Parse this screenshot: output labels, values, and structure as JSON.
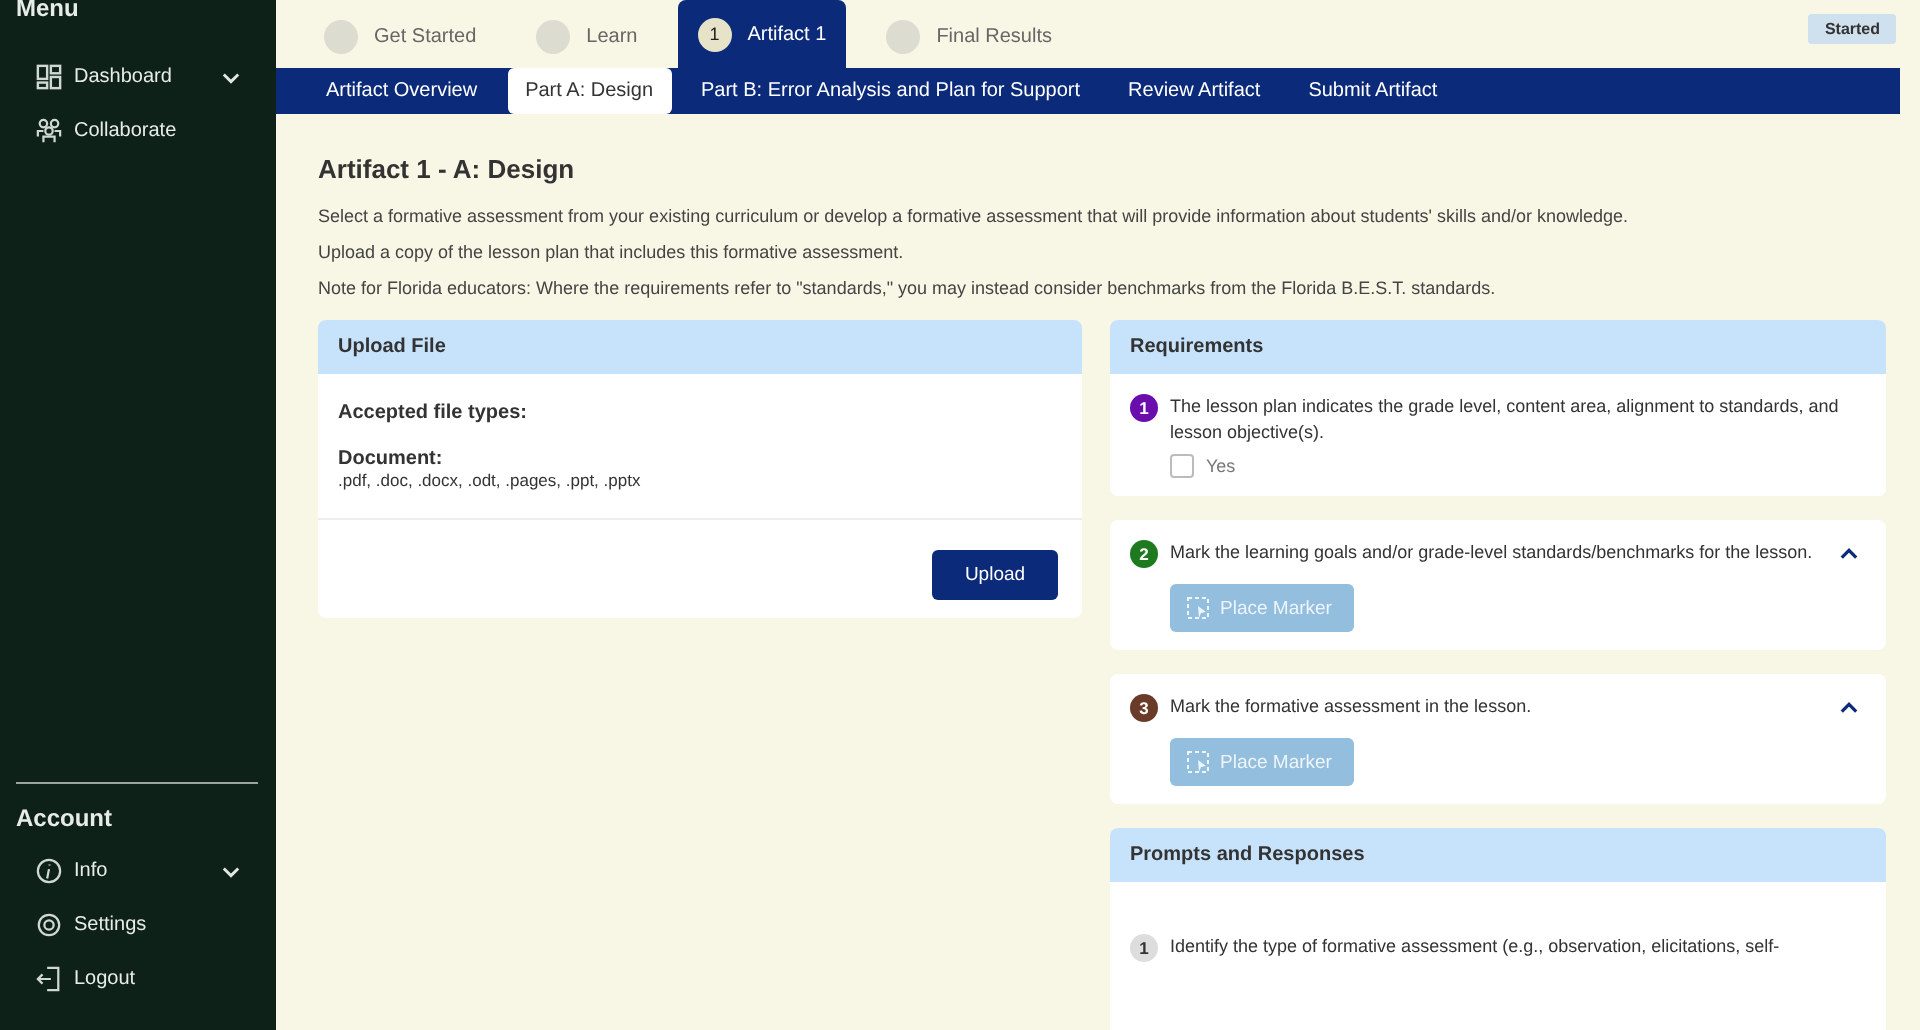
{
  "sidebar": {
    "menu_title": "Menu",
    "menu_items": [
      {
        "label": "Dashboard",
        "kind": "dashboard",
        "expandable": true
      },
      {
        "label": "Collaborate",
        "kind": "people",
        "expandable": false
      }
    ],
    "account_title": "Account",
    "account_items": [
      {
        "label": "Info",
        "kind": "info",
        "expandable": true
      },
      {
        "label": "Settings",
        "kind": "gear",
        "expandable": false
      },
      {
        "label": "Logout",
        "kind": "logout",
        "expandable": false
      }
    ]
  },
  "steps": [
    {
      "label": "Get Started",
      "selected": false
    },
    {
      "label": "Learn",
      "selected": false
    },
    {
      "label": "Artifact 1",
      "number": "1",
      "selected": true
    },
    {
      "label": "Final Results",
      "selected": false
    }
  ],
  "status_badge": "Started",
  "subtabs": [
    {
      "label": "Artifact Overview",
      "selected": false
    },
    {
      "label": "Part A: Design",
      "selected": true
    },
    {
      "label": "Part B: Error Analysis and Plan for Support",
      "selected": false
    },
    {
      "label": "Review Artifact",
      "selected": false
    },
    {
      "label": "Submit Artifact",
      "selected": false
    }
  ],
  "page_title": "Artifact 1 - A: Design",
  "instructions": [
    "Select a formative assessment from your existing curriculum or develop a formative assessment that will provide information about students' skills and/or knowledge.",
    "Upload a copy of the lesson plan that includes this formative assessment.",
    "Note for Florida educators: Where the requirements refer to \"standards,\" you may instead consider benchmarks from the Florida B.E.S.T. standards."
  ],
  "upload": {
    "title": "Upload File",
    "accepted_label": "Accepted file types:",
    "type_label": "Document:",
    "types": ".pdf, .doc, .docx, .odt, .pages, .ppt, .pptx",
    "button": "Upload"
  },
  "requirements": {
    "title": "Requirements",
    "items": [
      {
        "kind": "checkbox",
        "number": "1",
        "color": "#6a0dad",
        "text": "The lesson plan indicates the grade level, content area, alignment to standards, and lesson objective(s).",
        "option": "Yes",
        "checked": false
      },
      {
        "kind": "marker",
        "number": "2",
        "color": "#1e7a1e",
        "text": "Mark the learning goals and/or grade-level standards/benchmarks for the lesson.",
        "button": "Place Marker",
        "disabled": true,
        "expanded": true
      },
      {
        "kind": "marker",
        "number": "3",
        "color": "#6b3b2a",
        "text": "Mark the formative assessment in the lesson.",
        "button": "Place Marker",
        "disabled": true,
        "expanded": true
      }
    ]
  },
  "prompts": {
    "title": "Prompts and Responses",
    "items": [
      {
        "number": "1",
        "text": "Identify the type of formative assessment (e.g., observation, elicitations, self-"
      }
    ]
  }
}
